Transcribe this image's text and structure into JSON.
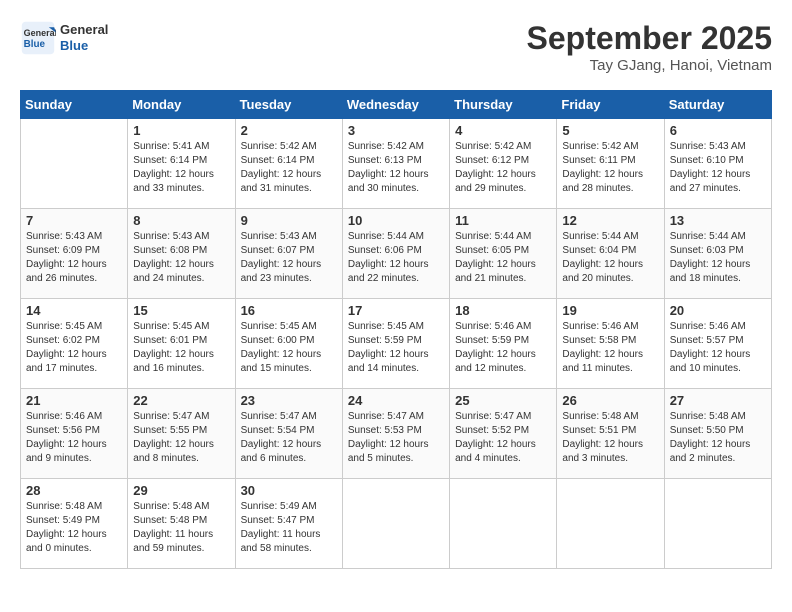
{
  "header": {
    "logo_line1": "General",
    "logo_line2": "Blue",
    "month": "September 2025",
    "location": "Tay GJang, Hanoi, Vietnam"
  },
  "weekdays": [
    "Sunday",
    "Monday",
    "Tuesday",
    "Wednesday",
    "Thursday",
    "Friday",
    "Saturday"
  ],
  "weeks": [
    [
      {
        "day": "",
        "info": ""
      },
      {
        "day": "1",
        "info": "Sunrise: 5:41 AM\nSunset: 6:14 PM\nDaylight: 12 hours\nand 33 minutes."
      },
      {
        "day": "2",
        "info": "Sunrise: 5:42 AM\nSunset: 6:14 PM\nDaylight: 12 hours\nand 31 minutes."
      },
      {
        "day": "3",
        "info": "Sunrise: 5:42 AM\nSunset: 6:13 PM\nDaylight: 12 hours\nand 30 minutes."
      },
      {
        "day": "4",
        "info": "Sunrise: 5:42 AM\nSunset: 6:12 PM\nDaylight: 12 hours\nand 29 minutes."
      },
      {
        "day": "5",
        "info": "Sunrise: 5:42 AM\nSunset: 6:11 PM\nDaylight: 12 hours\nand 28 minutes."
      },
      {
        "day": "6",
        "info": "Sunrise: 5:43 AM\nSunset: 6:10 PM\nDaylight: 12 hours\nand 27 minutes."
      }
    ],
    [
      {
        "day": "7",
        "info": "Sunrise: 5:43 AM\nSunset: 6:09 PM\nDaylight: 12 hours\nand 26 minutes."
      },
      {
        "day": "8",
        "info": "Sunrise: 5:43 AM\nSunset: 6:08 PM\nDaylight: 12 hours\nand 24 minutes."
      },
      {
        "day": "9",
        "info": "Sunrise: 5:43 AM\nSunset: 6:07 PM\nDaylight: 12 hours\nand 23 minutes."
      },
      {
        "day": "10",
        "info": "Sunrise: 5:44 AM\nSunset: 6:06 PM\nDaylight: 12 hours\nand 22 minutes."
      },
      {
        "day": "11",
        "info": "Sunrise: 5:44 AM\nSunset: 6:05 PM\nDaylight: 12 hours\nand 21 minutes."
      },
      {
        "day": "12",
        "info": "Sunrise: 5:44 AM\nSunset: 6:04 PM\nDaylight: 12 hours\nand 20 minutes."
      },
      {
        "day": "13",
        "info": "Sunrise: 5:44 AM\nSunset: 6:03 PM\nDaylight: 12 hours\nand 18 minutes."
      }
    ],
    [
      {
        "day": "14",
        "info": "Sunrise: 5:45 AM\nSunset: 6:02 PM\nDaylight: 12 hours\nand 17 minutes."
      },
      {
        "day": "15",
        "info": "Sunrise: 5:45 AM\nSunset: 6:01 PM\nDaylight: 12 hours\nand 16 minutes."
      },
      {
        "day": "16",
        "info": "Sunrise: 5:45 AM\nSunset: 6:00 PM\nDaylight: 12 hours\nand 15 minutes."
      },
      {
        "day": "17",
        "info": "Sunrise: 5:45 AM\nSunset: 5:59 PM\nDaylight: 12 hours\nand 14 minutes."
      },
      {
        "day": "18",
        "info": "Sunrise: 5:46 AM\nSunset: 5:59 PM\nDaylight: 12 hours\nand 12 minutes."
      },
      {
        "day": "19",
        "info": "Sunrise: 5:46 AM\nSunset: 5:58 PM\nDaylight: 12 hours\nand 11 minutes."
      },
      {
        "day": "20",
        "info": "Sunrise: 5:46 AM\nSunset: 5:57 PM\nDaylight: 12 hours\nand 10 minutes."
      }
    ],
    [
      {
        "day": "21",
        "info": "Sunrise: 5:46 AM\nSunset: 5:56 PM\nDaylight: 12 hours\nand 9 minutes."
      },
      {
        "day": "22",
        "info": "Sunrise: 5:47 AM\nSunset: 5:55 PM\nDaylight: 12 hours\nand 8 minutes."
      },
      {
        "day": "23",
        "info": "Sunrise: 5:47 AM\nSunset: 5:54 PM\nDaylight: 12 hours\nand 6 minutes."
      },
      {
        "day": "24",
        "info": "Sunrise: 5:47 AM\nSunset: 5:53 PM\nDaylight: 12 hours\nand 5 minutes."
      },
      {
        "day": "25",
        "info": "Sunrise: 5:47 AM\nSunset: 5:52 PM\nDaylight: 12 hours\nand 4 minutes."
      },
      {
        "day": "26",
        "info": "Sunrise: 5:48 AM\nSunset: 5:51 PM\nDaylight: 12 hours\nand 3 minutes."
      },
      {
        "day": "27",
        "info": "Sunrise: 5:48 AM\nSunset: 5:50 PM\nDaylight: 12 hours\nand 2 minutes."
      }
    ],
    [
      {
        "day": "28",
        "info": "Sunrise: 5:48 AM\nSunset: 5:49 PM\nDaylight: 12 hours\nand 0 minutes."
      },
      {
        "day": "29",
        "info": "Sunrise: 5:48 AM\nSunset: 5:48 PM\nDaylight: 11 hours\nand 59 minutes."
      },
      {
        "day": "30",
        "info": "Sunrise: 5:49 AM\nSunset: 5:47 PM\nDaylight: 11 hours\nand 58 minutes."
      },
      {
        "day": "",
        "info": ""
      },
      {
        "day": "",
        "info": ""
      },
      {
        "day": "",
        "info": ""
      },
      {
        "day": "",
        "info": ""
      }
    ]
  ]
}
